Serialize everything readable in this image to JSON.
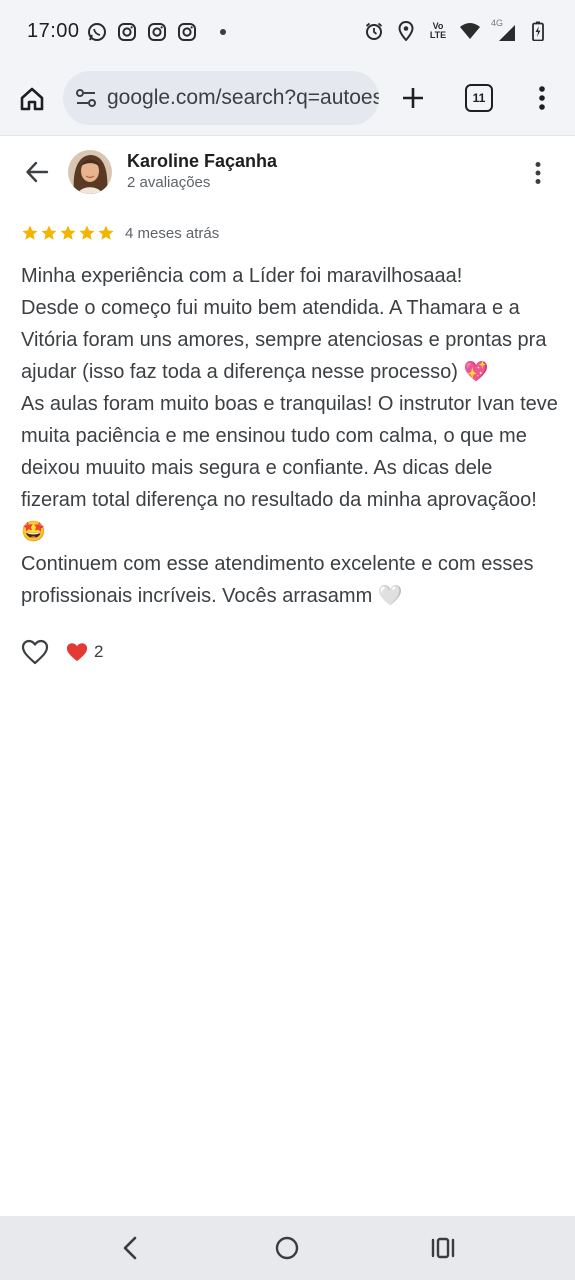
{
  "status_bar": {
    "time": "17:00",
    "left_icons": [
      "whatsapp-icon",
      "instagram-icon",
      "instagram-icon",
      "instagram-icon",
      "dot"
    ],
    "right_icons": [
      "alarm-icon",
      "location-icon",
      "volte-icon",
      "wifi-icon",
      "signal-4g-icon",
      "battery-icon"
    ],
    "volte_label_top": "Vo",
    "volte_label_bottom": "LTE",
    "network_label": "4G"
  },
  "browser": {
    "url": "google.com/search?q=autoescola",
    "tab_count": "11"
  },
  "review": {
    "reviewer_name": "Karoline Façanha",
    "reviewer_review_count": "2 avaliações",
    "rating": 5,
    "date": "4 meses atrás",
    "text": "Minha experiência com a Líder foi maravilhosaaa!\nDesde o começo fui muito bem atendida. A Thamara e a Vitória foram uns amores, sempre atenciosas e prontas pra ajudar (isso faz toda a diferença nesse processo) 💖\nAs aulas foram muito boas e tranquilas! O instrutor Ivan teve muita paciência e me ensinou tudo com calma, o que me deixou muuito mais segura e confiante. As dicas dele fizeram total diferença no resultado da minha aprovaçãoo! 🤩\nContinuem com esse atendimento excelente e com esses profissionais incríveis. Vocês arrasamm 🤍",
    "reaction_count": "2"
  },
  "colors": {
    "star": "#f4b400",
    "heart": "#e53935",
    "chrome_bg": "#f2f4f8",
    "omnibox_bg": "#e5e8ee",
    "nav_bg": "#e8e9ed"
  }
}
